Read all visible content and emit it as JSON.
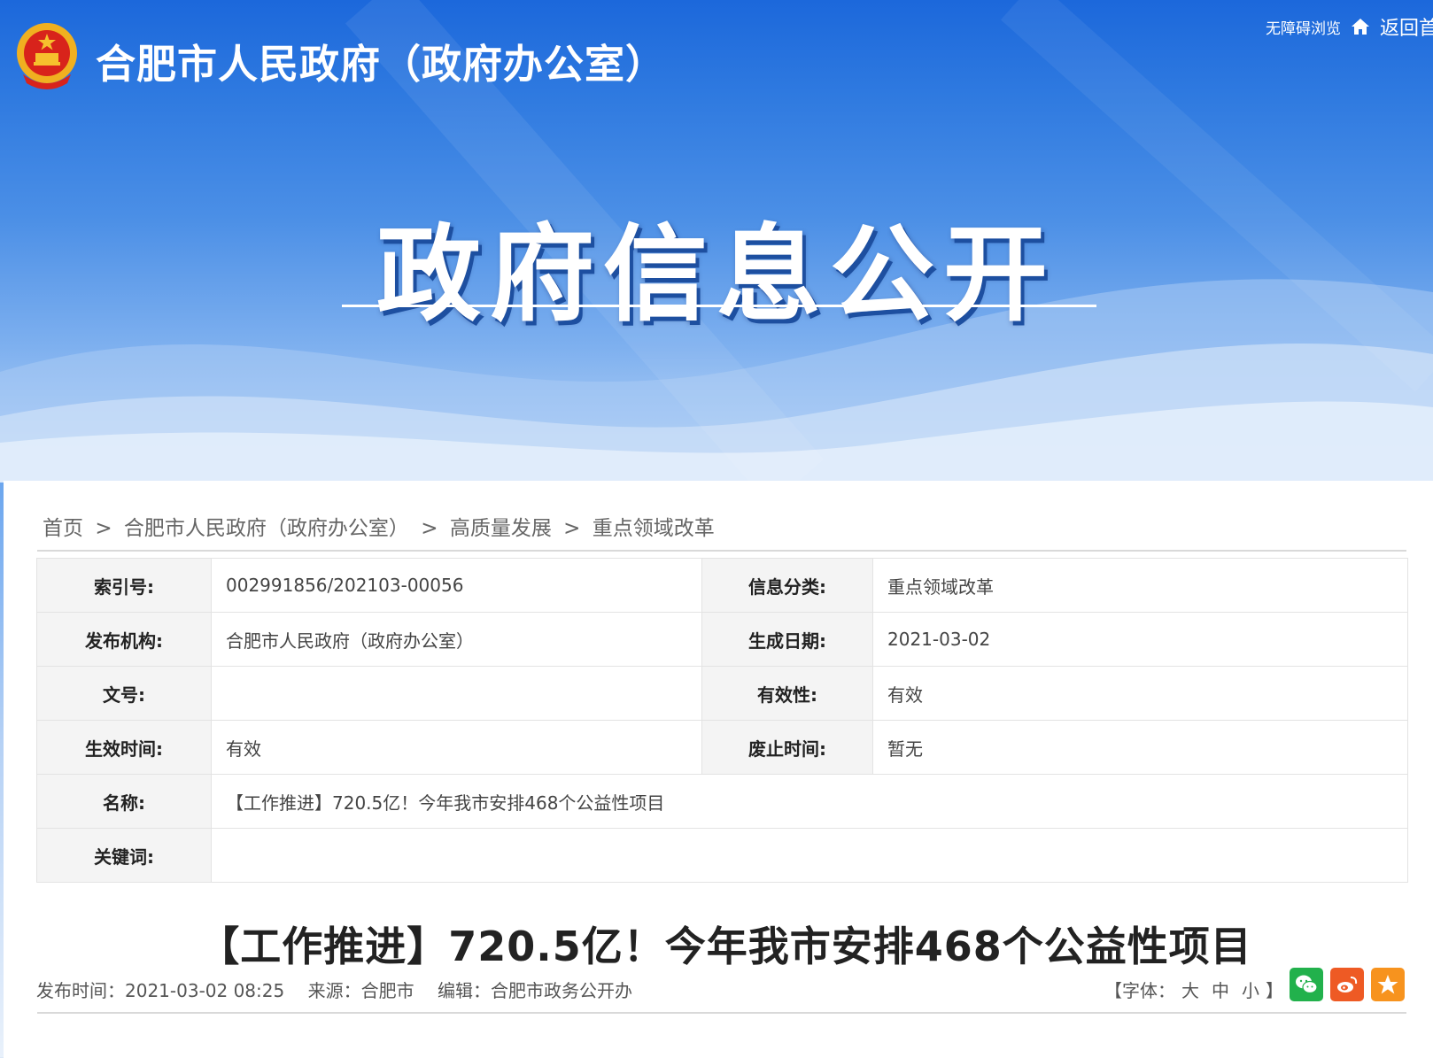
{
  "header": {
    "site_name": "合肥市人民政府（政府办公室）",
    "accessibility_link": "无障碍浏览",
    "back_home_link": "返回首",
    "banner_title": "政府信息公开"
  },
  "breadcrumb": {
    "items": [
      "首页",
      "合肥市人民政府（政府办公室）",
      "高质量发展",
      "重点领域改革"
    ],
    "separator": ">"
  },
  "meta": {
    "index_no": {
      "label": "索引号:",
      "value": "002991856/202103-00056"
    },
    "category": {
      "label": "信息分类:",
      "value": "重点领域改革"
    },
    "publisher": {
      "label": "发布机构:",
      "value": "合肥市人民政府（政府办公室）"
    },
    "created_date": {
      "label": "生成日期:",
      "value": "2021-03-02"
    },
    "doc_no": {
      "label": "文号:",
      "value": ""
    },
    "validity": {
      "label": "有效性:",
      "value": "有效"
    },
    "effective_time": {
      "label": "生效时间:",
      "value": "有效"
    },
    "abolish_time": {
      "label": "废止时间:",
      "value": "暂无"
    },
    "name": {
      "label": "名称:",
      "value": "【工作推进】720.5亿！今年我市安排468个公益性项目"
    },
    "keywords": {
      "label": "关键词:",
      "value": ""
    }
  },
  "article": {
    "title": "【工作推进】720.5亿！今年我市安排468个公益性项目",
    "publish_time": "发布时间：2021-03-02 08:25",
    "source": "来源：合肥市",
    "editor": "编辑：合肥市政务公开办",
    "font_size_prefix": "【字体：",
    "font_large": "大",
    "font_medium": "中",
    "font_small": "小",
    "font_size_suffix": "】"
  },
  "share": {
    "icons": [
      "wechat-icon",
      "weibo-icon",
      "favorite-icon"
    ],
    "colors": {
      "wechat": "#22b14c",
      "weibo": "#ee5a24",
      "favorite": "#f7931e"
    }
  },
  "colors": {
    "banner_blue": "#1c68db",
    "label_bg": "#f4f4f4"
  }
}
